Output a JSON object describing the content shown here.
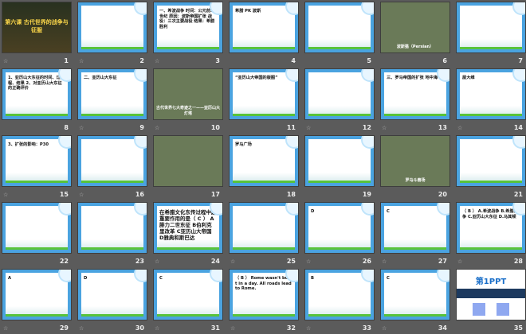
{
  "view": "slide-sorter",
  "colors": {
    "background": "#5b5b5b",
    "template_border": "#4aa3e0",
    "grass": "#58c33a"
  },
  "transition_icon": "transition-star-icon",
  "slides": [
    {
      "n": "1",
      "kind": "dark",
      "text": "第六课 古代世界的战争与征服",
      "star": true
    },
    {
      "n": "2",
      "kind": "tpl",
      "text": "",
      "star": true
    },
    {
      "n": "3",
      "kind": "tpl",
      "text": "一、希波战争 时间：公元前5世纪 原因：波斯帝国扩张 战役：三次主要战役 结果：希腊胜利",
      "star": true
    },
    {
      "n": "4",
      "kind": "tpl",
      "text": "希腊 PK 波斯",
      "star": false
    },
    {
      "n": "5",
      "kind": "tpl",
      "text": "",
      "star": false
    },
    {
      "n": "6",
      "kind": "photo",
      "text": "波斯猫（Persian）",
      "star": false
    },
    {
      "n": "7",
      "kind": "tpl",
      "text": "",
      "star": false
    },
    {
      "n": "8",
      "kind": "tpl",
      "text": "1、亚历山大东征的时间、过程、结果 2、对亚历山大东征的正确评价",
      "star": false
    },
    {
      "n": "9",
      "kind": "tpl",
      "text": "二、亚历山大东征",
      "star": true
    },
    {
      "n": "10",
      "kind": "photo",
      "text": "古代世界七大奇迹之一——亚历山大灯塔",
      "star": true
    },
    {
      "n": "11",
      "kind": "tpl",
      "text": "“亚历山大帝国的版图”",
      "star": false
    },
    {
      "n": "12",
      "kind": "tpl",
      "text": "",
      "star": true
    },
    {
      "n": "13",
      "kind": "tpl",
      "text": "三、罗马帝国的扩张 地中海",
      "star": true
    },
    {
      "n": "14",
      "kind": "tpl",
      "text": "屋大维",
      "star": true
    },
    {
      "n": "15",
      "kind": "tpl",
      "text": "3、扩张的影响：P30",
      "star": true
    },
    {
      "n": "16",
      "kind": "tpl",
      "text": "",
      "star": true
    },
    {
      "n": "17",
      "kind": "photo",
      "text": "",
      "star": false
    },
    {
      "n": "18",
      "kind": "tpl",
      "text": "罗马广场",
      "star": false
    },
    {
      "n": "19",
      "kind": "tpl",
      "text": "",
      "star": false
    },
    {
      "n": "20",
      "kind": "photo",
      "text": "罗马斗兽场",
      "star": false
    },
    {
      "n": "21",
      "kind": "tpl",
      "text": "",
      "star": false
    },
    {
      "n": "22",
      "kind": "tpl",
      "text": "",
      "star": false
    },
    {
      "n": "23",
      "kind": "tpl",
      "text": "",
      "star": false
    },
    {
      "n": "24",
      "kind": "tpl",
      "text": "在希腊文化东传过程中起重要作用的是（ C ） A腓力二世东征 B伯利克里改革 C亚历山大帝国 D雅典和斯巴达",
      "star": true
    },
    {
      "n": "25",
      "kind": "tpl",
      "text": "",
      "star": true
    },
    {
      "n": "26",
      "kind": "tpl",
      "text": "D",
      "star": true
    },
    {
      "n": "27",
      "kind": "tpl",
      "text": "C",
      "star": true
    },
    {
      "n": "28",
      "kind": "tpl",
      "text": "（ B ） A.希波战争 B.希腊战争 C.亚历山大东征 D.马其顿",
      "star": true
    },
    {
      "n": "29",
      "kind": "tpl",
      "text": "A",
      "star": true
    },
    {
      "n": "30",
      "kind": "tpl",
      "text": "D",
      "star": true
    },
    {
      "n": "31",
      "kind": "tpl",
      "text": "C",
      "star": true
    },
    {
      "n": "32",
      "kind": "tpl",
      "text": "（ B ） Rome wasn't built in a day. All roads lead to Rome.",
      "star": true
    },
    {
      "n": "33",
      "kind": "tpl",
      "text": "B",
      "star": true
    },
    {
      "n": "34",
      "kind": "tpl",
      "text": "C",
      "star": true
    },
    {
      "n": "35",
      "kind": "logo",
      "text": "第1PPT",
      "star": false
    }
  ]
}
